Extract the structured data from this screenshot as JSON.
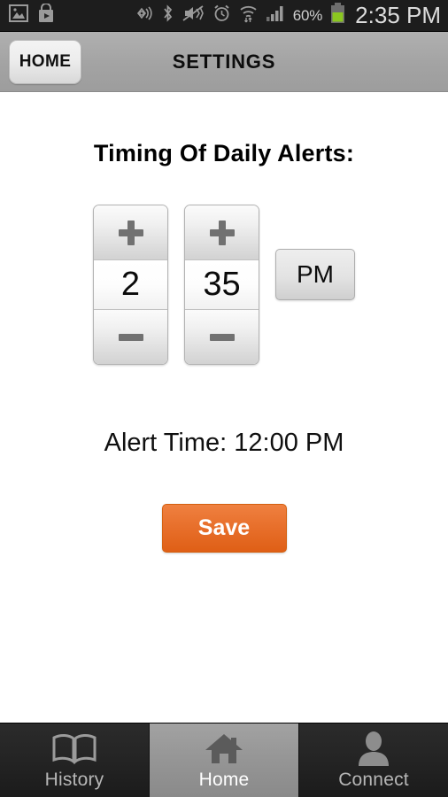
{
  "status_bar": {
    "left_icons": [
      {
        "name": "gallery-image-icon",
        "label": "Gallery"
      },
      {
        "name": "play-store-icon",
        "label": "Play Store"
      }
    ],
    "right_icons": [
      {
        "name": "nfc-beam-icon",
        "label": "S Beam"
      },
      {
        "name": "bluetooth-icon",
        "label": "Bluetooth"
      },
      {
        "name": "vibrate-mute-icon",
        "label": "Sound off"
      },
      {
        "name": "alarm-clock-icon",
        "label": "Alarm"
      },
      {
        "name": "wifi-icon",
        "label": "Wi-Fi"
      },
      {
        "name": "cellular-signal-icon",
        "label": "Signal"
      }
    ],
    "battery_percent": "60%",
    "battery_level": 60,
    "battery_color": "#8bc720",
    "time": "2:35 PM"
  },
  "action_bar": {
    "home_button": "HOME",
    "title": "SETTINGS"
  },
  "main": {
    "heading": "Timing Of Daily Alerts:",
    "hour_stepper": {
      "value": "2",
      "increment_label": "+",
      "decrement_label": "−"
    },
    "minute_stepper": {
      "value": "35",
      "increment_label": "+",
      "decrement_label": "−"
    },
    "ampm_button": "PM",
    "alert_time_text": "Alert Time: 12:00 PM",
    "save_button": "Save",
    "save_button_color": "#e8702c"
  },
  "tab_bar": {
    "tabs": [
      {
        "label": "History",
        "icon": "book-icon",
        "selected": false
      },
      {
        "label": "Home",
        "icon": "house-icon",
        "selected": true
      },
      {
        "label": "Connect",
        "icon": "person-icon",
        "selected": false
      }
    ]
  }
}
